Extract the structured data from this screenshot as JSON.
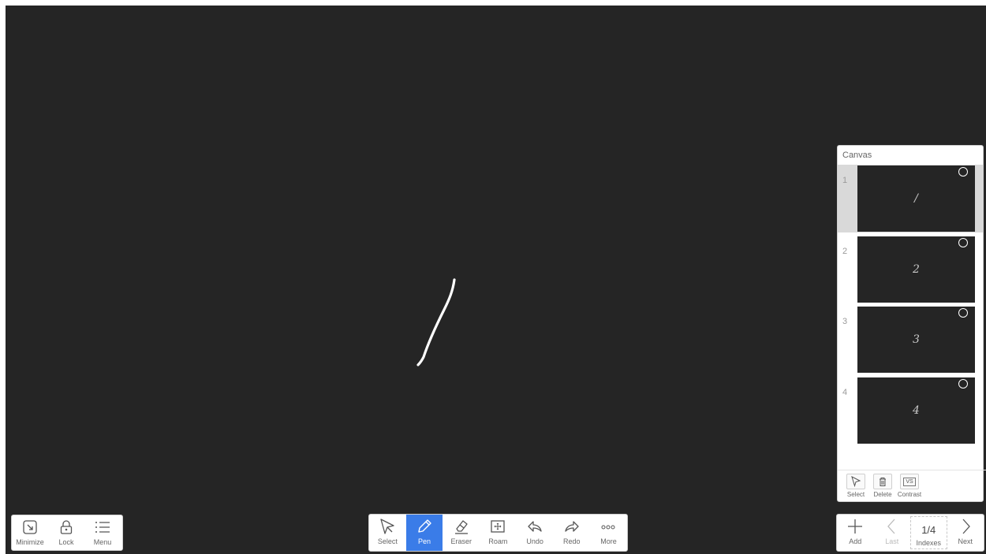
{
  "canvas_panel": {
    "title": "Canvas",
    "pages": [
      {
        "number": "1",
        "thumbnail_text": "/",
        "selected": true
      },
      {
        "number": "2",
        "thumbnail_text": "2",
        "selected": false
      },
      {
        "number": "3",
        "thumbnail_text": "3",
        "selected": false
      },
      {
        "number": "4",
        "thumbnail_text": "4",
        "selected": false
      }
    ],
    "actions": {
      "select": "Select",
      "delete": "Delete",
      "contrast": "Contrast",
      "contrast_icon_text": "VS"
    }
  },
  "left_toolbar": {
    "minimize": "Minimize",
    "lock": "Lock",
    "menu": "Menu"
  },
  "center_toolbar": {
    "select": "Select",
    "pen": "Pen",
    "eraser": "Eraser",
    "roam": "Roam",
    "undo": "Undo",
    "redo": "Redo",
    "more": "More",
    "active_tool": "Pen"
  },
  "right_toolbar": {
    "add": "Add",
    "last": "Last",
    "page_indicator": "1/4",
    "indexes": "Indexes",
    "next": "Next"
  },
  "colors": {
    "board_background": "#252525",
    "accent": "#3a7ce8",
    "stroke": "#ffffff"
  }
}
